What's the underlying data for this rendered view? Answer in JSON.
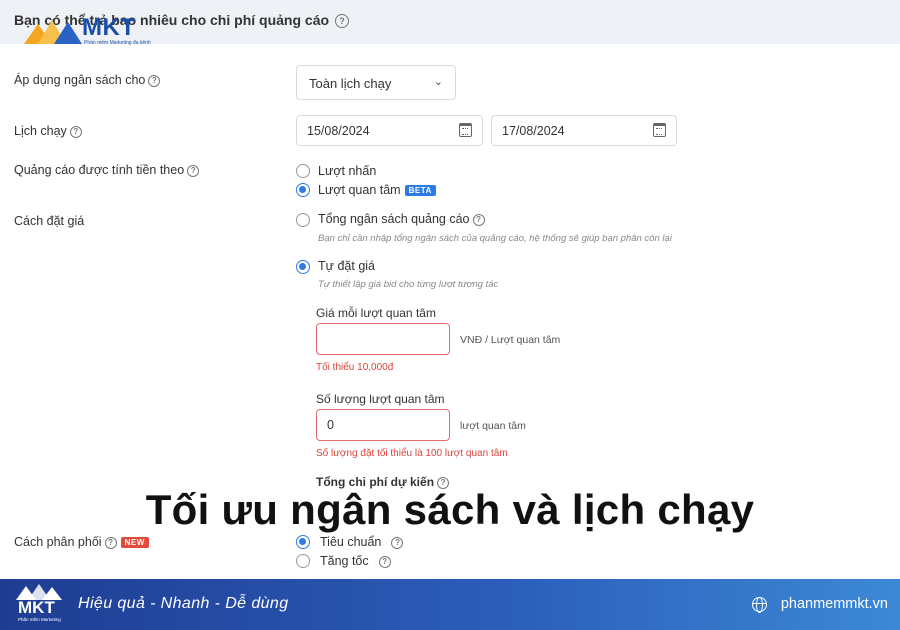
{
  "header": {
    "question": "Bạn có thể trả bao nhiêu cho chi phí quảng cáo",
    "help_glyph": "?"
  },
  "brand": {
    "logo_text": "MKT",
    "logo_sub": "Phần mềm Marketing đa kênh",
    "colors": {
      "primary": "#1a4fa8",
      "accent": "#2d7be5",
      "error": "#d9443a"
    }
  },
  "budget_apply": {
    "label": "Áp dụng ngân sách cho",
    "selected": "Toàn lịch chạy"
  },
  "schedule": {
    "label": "Lịch chạy",
    "start_date": "15/08/2024",
    "end_date": "17/08/2024"
  },
  "billing": {
    "label": "Quảng cáo được tính tiền theo",
    "options": [
      {
        "label": "Lượt nhấn",
        "selected": false
      },
      {
        "label": "Lượt quan tâm",
        "selected": true,
        "badge": "BETA"
      }
    ]
  },
  "bidding": {
    "label": "Cách đặt giá",
    "options": [
      {
        "label": "Tổng ngân sách quảng cáo",
        "hint": "Bạn chỉ cần nhập tổng ngân sách của quảng cáo, hệ thống sẽ giúp bạn phân còn lại",
        "selected": false
      },
      {
        "label": "Tự đặt giá",
        "hint": "Tự thiết lập giá bid cho từng lượt tương tác",
        "selected": true
      }
    ],
    "price_field": {
      "label": "Giá mỗi lượt quan tâm",
      "value": "",
      "unit": "VNĐ / Lượt quan tâm",
      "error": "Tối thiểu 10,000đ"
    },
    "quantity_field": {
      "label": "Số lượng lượt quan tâm",
      "value": "0",
      "unit": "lượt quan tâm",
      "error": "Số lượng đặt tối thiểu là 100 lượt quan tâm"
    },
    "total_label": "Tổng chi phí dự kiến"
  },
  "distribution": {
    "label": "Cách phân phối",
    "badge": "NEW",
    "options": [
      {
        "label": "Tiêu chuẩn",
        "selected": true
      },
      {
        "label": "Tăng tốc",
        "selected": false
      }
    ]
  },
  "overlay_title": "Tối ưu ngân sách và lịch chạy",
  "footer": {
    "logo_text": "MKT",
    "logo_sub": "Phần mềm Marketing",
    "slogan": "Hiệu quả - Nhanh  - Dễ dùng",
    "website": "phanmemmkt.vn"
  }
}
